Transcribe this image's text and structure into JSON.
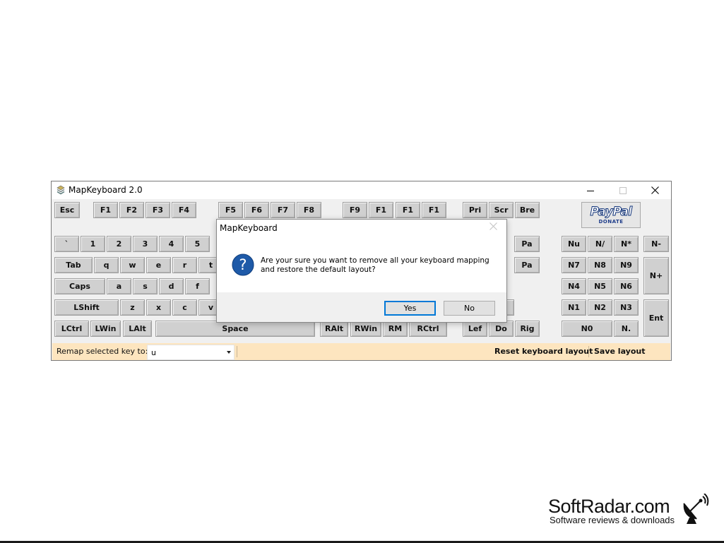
{
  "window": {
    "title": "MapKeyboard 2.0",
    "caption_buttons": [
      "minimize-icon",
      "maximize-icon",
      "close-icon"
    ]
  },
  "keys": {
    "row_fn": [
      "Esc",
      "F1",
      "F2",
      "F3",
      "F4",
      "F5",
      "F6",
      "F7",
      "F8",
      "F9",
      "F1",
      "F1",
      "F1",
      "Pri",
      "Scr",
      "Bre"
    ],
    "row_num": [
      "`",
      "1",
      "2",
      "3",
      "4",
      "5",
      "Pa",
      "Nu",
      "N/",
      "N*",
      "N-"
    ],
    "row_tab": [
      "Tab",
      "q",
      "w",
      "e",
      "r",
      "t",
      "Pa",
      "N7",
      "N8",
      "N9",
      "N+"
    ],
    "row_caps": [
      "Caps",
      "a",
      "s",
      "d",
      "f",
      "N4",
      "N5",
      "N6"
    ],
    "row_shift": [
      "LShift",
      "z",
      "x",
      "c",
      "v",
      "N1",
      "N2",
      "N3",
      "Ent"
    ],
    "row_ctrl": [
      "LCtrl",
      "LWin",
      "LAlt",
      "Space",
      "RAlt",
      "RWin",
      "RM",
      "RCtrl",
      "Lef",
      "Do",
      "Rig",
      "N0",
      "N."
    ]
  },
  "paypal": {
    "logo": "PayPal",
    "label": "DONATE"
  },
  "status": {
    "remap_label": "Remap selected key to:",
    "remap_value": "u",
    "reset_label": "Reset keyboard layout",
    "save_label": "Save layout"
  },
  "dialog": {
    "title": "MapKeyboard",
    "message_line1": "Are your sure you want to remove all your keyboard mapping",
    "message_line2": "and restore the default layout?",
    "yes_label": "Yes",
    "no_label": "No",
    "icon": "question-icon"
  },
  "watermark": {
    "title": "SoftRadar.com",
    "subtitle": "Software reviews & downloads",
    "icon": "satellite-dish-icon"
  }
}
